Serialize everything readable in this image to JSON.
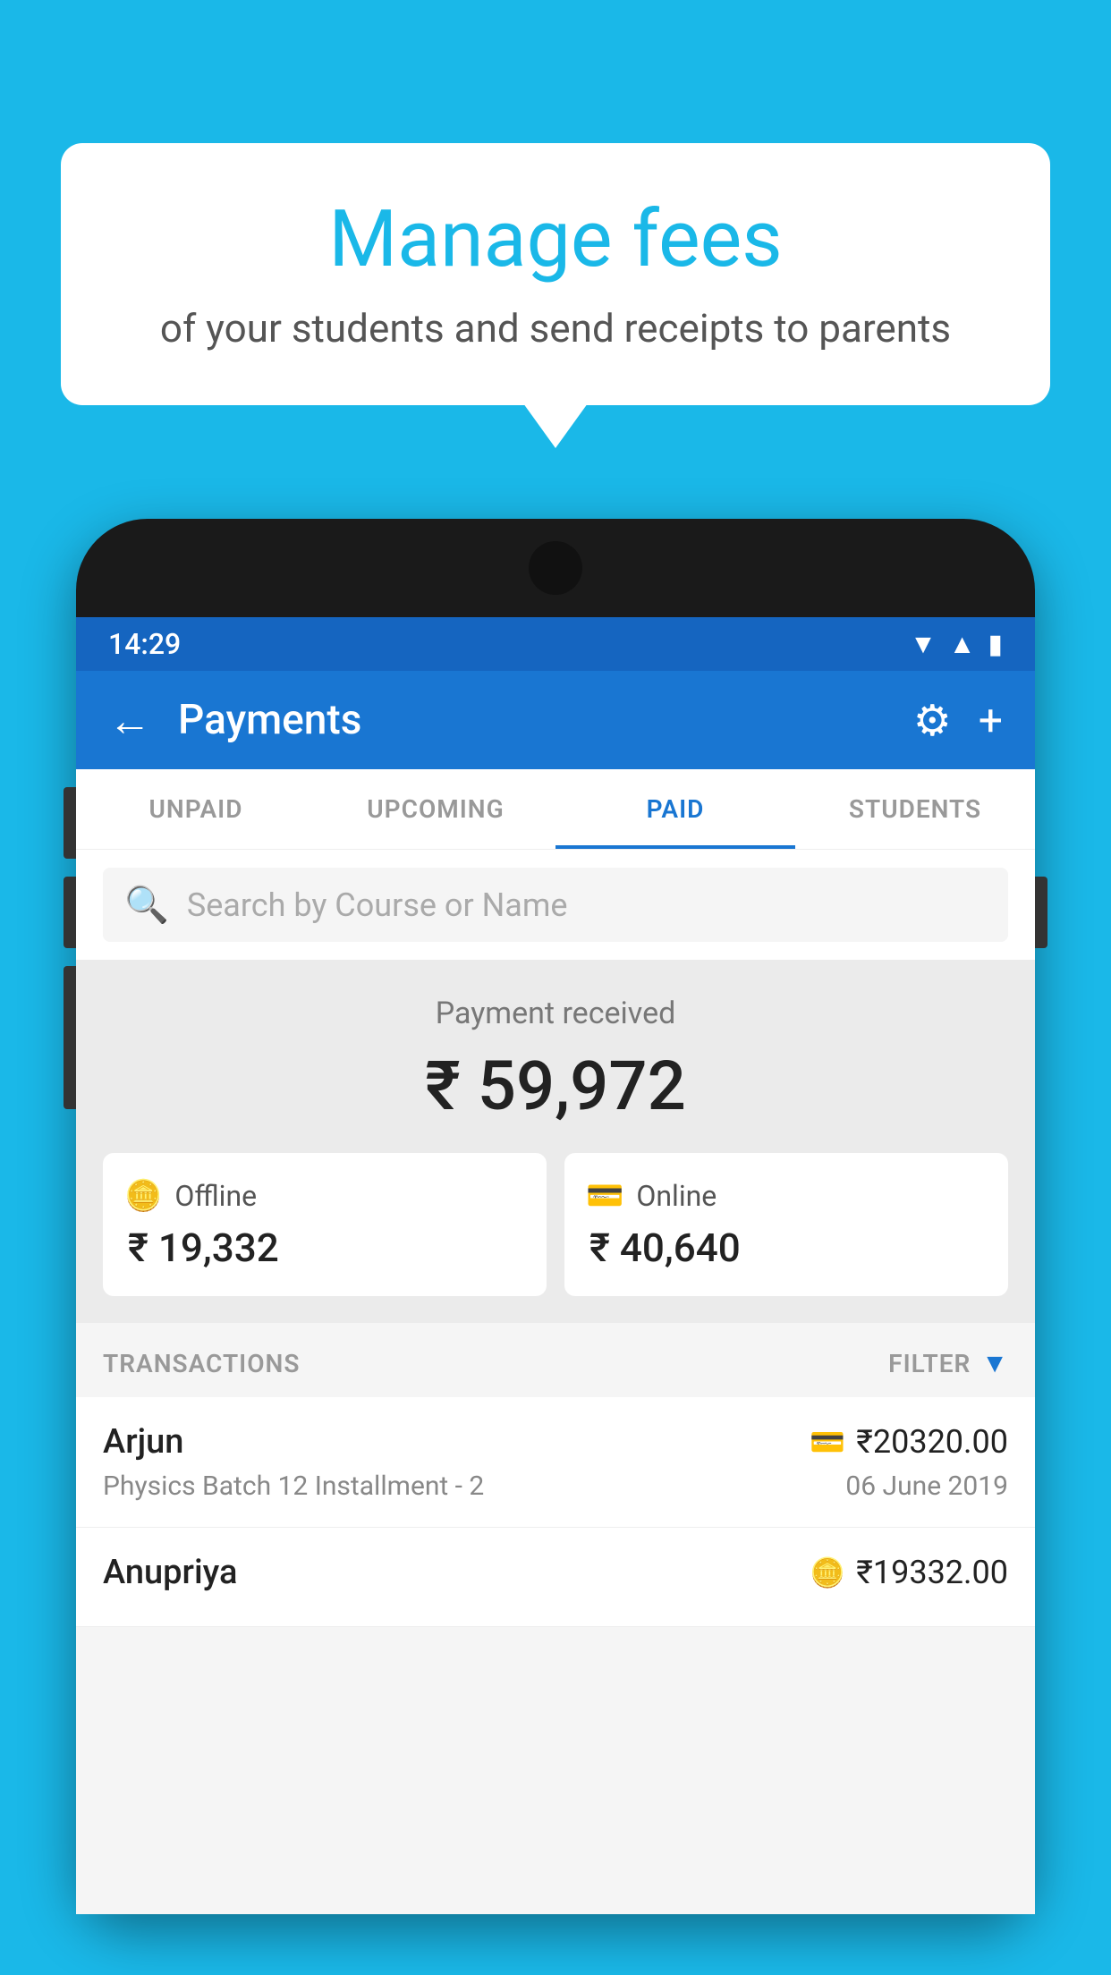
{
  "background_color": "#1AB8E8",
  "bubble": {
    "title": "Manage fees",
    "subtitle": "of your students and send receipts to parents"
  },
  "status_bar": {
    "time": "14:29",
    "icons": [
      "wifi",
      "signal",
      "battery"
    ]
  },
  "app_bar": {
    "title": "Payments",
    "back_label": "←",
    "settings_label": "⚙",
    "add_label": "+"
  },
  "tabs": [
    {
      "label": "UNPAID",
      "active": false
    },
    {
      "label": "UPCOMING",
      "active": false
    },
    {
      "label": "PAID",
      "active": true
    },
    {
      "label": "STUDENTS",
      "active": false
    }
  ],
  "search": {
    "placeholder": "Search by Course or Name"
  },
  "payment_summary": {
    "label": "Payment received",
    "total": "₹ 59,972",
    "offline": {
      "type": "Offline",
      "amount": "₹ 19,332"
    },
    "online": {
      "type": "Online",
      "amount": "₹ 40,640"
    }
  },
  "transactions_header": {
    "label": "TRANSACTIONS",
    "filter_label": "FILTER"
  },
  "transactions": [
    {
      "name": "Arjun",
      "course": "Physics Batch 12 Installment - 2",
      "amount": "₹20320.00",
      "date": "06 June 2019",
      "type": "online"
    },
    {
      "name": "Anupriya",
      "course": "",
      "amount": "₹19332.00",
      "date": "",
      "type": "offline"
    }
  ]
}
